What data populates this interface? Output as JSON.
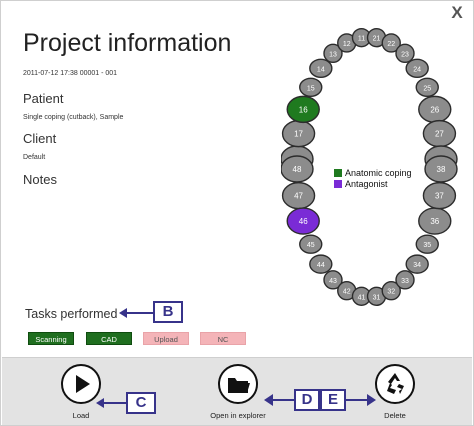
{
  "window": {
    "close_label": "X"
  },
  "header": {
    "title": "Project information",
    "meta": "2011-07-12 17:38   00001 - 001"
  },
  "patient": {
    "heading": "Patient",
    "value": "Single coping (cutback), Sample"
  },
  "client": {
    "heading": "Client",
    "value": "Default"
  },
  "notes": {
    "heading": "Notes"
  },
  "tasks": {
    "heading": "Tasks performed",
    "items": [
      {
        "label": "Scanning",
        "done": true
      },
      {
        "label": "CAD",
        "done": true
      },
      {
        "label": "Upload",
        "done": false
      },
      {
        "label": "NC",
        "done": false
      }
    ]
  },
  "callouts": {
    "b": "B",
    "c": "C",
    "d": "D",
    "e": "E"
  },
  "legend": {
    "items": [
      {
        "label": "Anatomic coping",
        "color": "#1f7a1f"
      },
      {
        "label": "Antagonist",
        "color": "#7a2bd6"
      }
    ]
  },
  "teeth": {
    "upper": [
      "18",
      "17",
      "16",
      "15",
      "14",
      "13",
      "12",
      "11",
      "21",
      "22",
      "23",
      "24",
      "25",
      "26",
      "27",
      "28"
    ],
    "lower": [
      "48",
      "47",
      "46",
      "45",
      "44",
      "43",
      "42",
      "41",
      "31",
      "32",
      "33",
      "34",
      "35",
      "36",
      "37",
      "38"
    ],
    "highlighted": {
      "16": "#1f7a1f",
      "46": "#7a2bd6"
    }
  },
  "footer": {
    "load_label": "Load",
    "open_label": "Open in explorer",
    "delete_label": "Delete"
  },
  "colors": {
    "accent": "#37338a",
    "task_done": "#1f6e1f",
    "task_pending": "#f4b4b8",
    "footer_bg": "#e3e3e3"
  }
}
